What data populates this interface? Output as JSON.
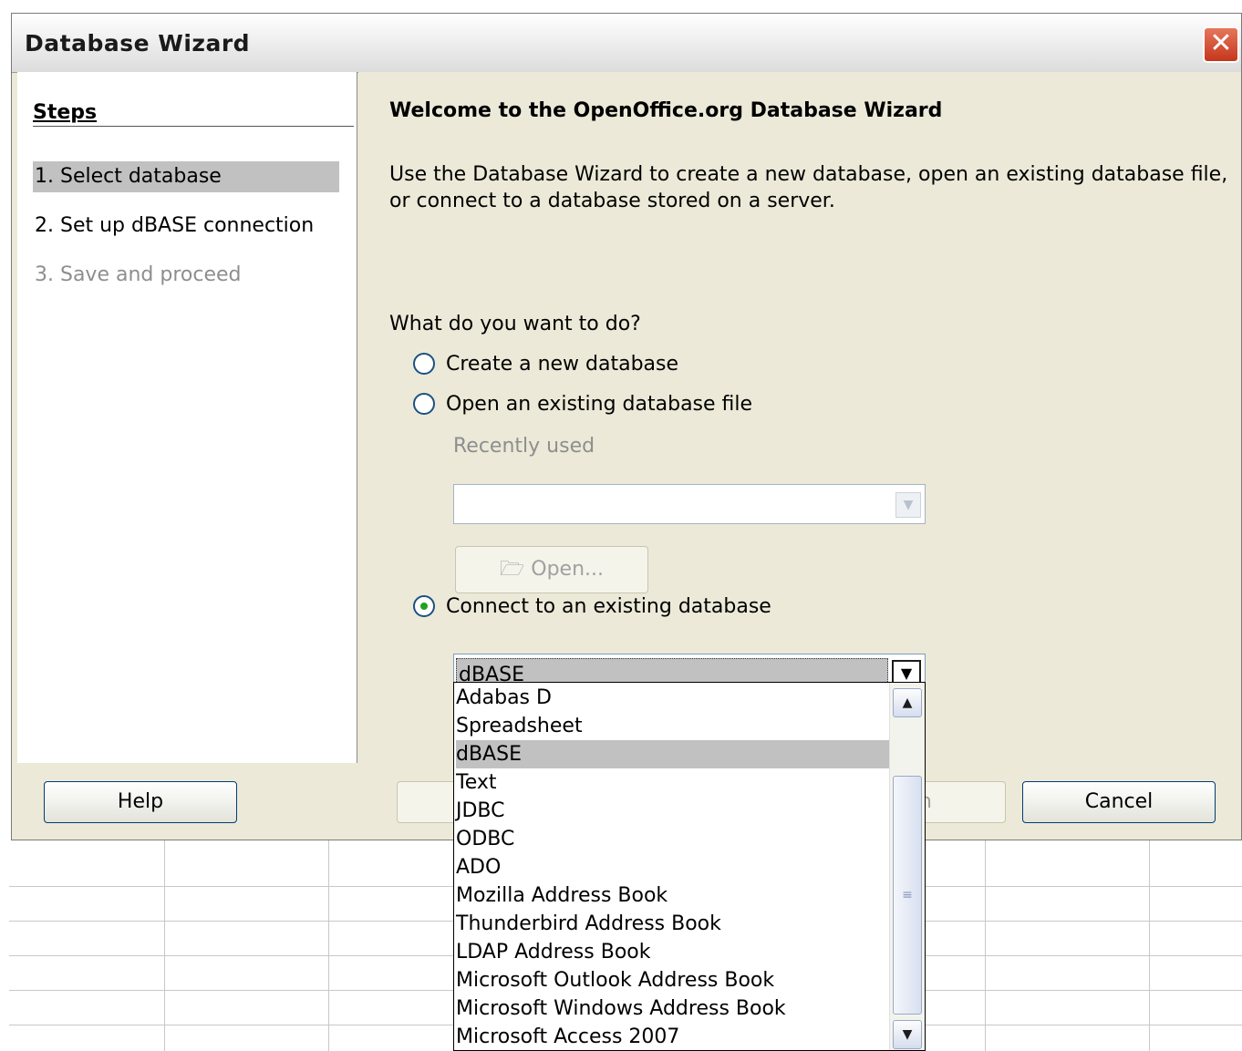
{
  "window": {
    "title": "Database Wizard",
    "close_glyph": "✕"
  },
  "steps": {
    "heading": "Steps",
    "items": [
      {
        "label": "1. Select database",
        "state": "active"
      },
      {
        "label": "2. Set up dBASE connection",
        "state": "normal"
      },
      {
        "label": "3. Save and proceed",
        "state": "disabled"
      }
    ]
  },
  "content": {
    "welcome": "Welcome to the OpenOffice.org Database Wizard",
    "intro": "Use the Database Wizard to create a new database, open an existing database file, or connect to a database stored on a server.",
    "question": "What do you want to do?",
    "options": {
      "create": "Create a new database",
      "open": "Open an existing database file",
      "connect": "Connect to an existing database"
    },
    "selected_option": "connect",
    "recently_used_label": "Recently used",
    "recently_used_value": "",
    "open_button": "Open...",
    "database_type": "dBASE"
  },
  "dropdown": {
    "items": [
      "Adabas D",
      "Spreadsheet",
      "dBASE",
      "Text",
      "JDBC",
      "ODBC",
      "ADO",
      "Mozilla Address Book",
      "Thunderbird Address Book",
      "LDAP Address Book",
      "Microsoft Outlook Address Book",
      "Microsoft Windows Address Book",
      "Microsoft Access 2007"
    ],
    "selected": "dBASE"
  },
  "buttons": {
    "help": "Help",
    "back": "",
    "finish": "n",
    "cancel": "Cancel"
  }
}
